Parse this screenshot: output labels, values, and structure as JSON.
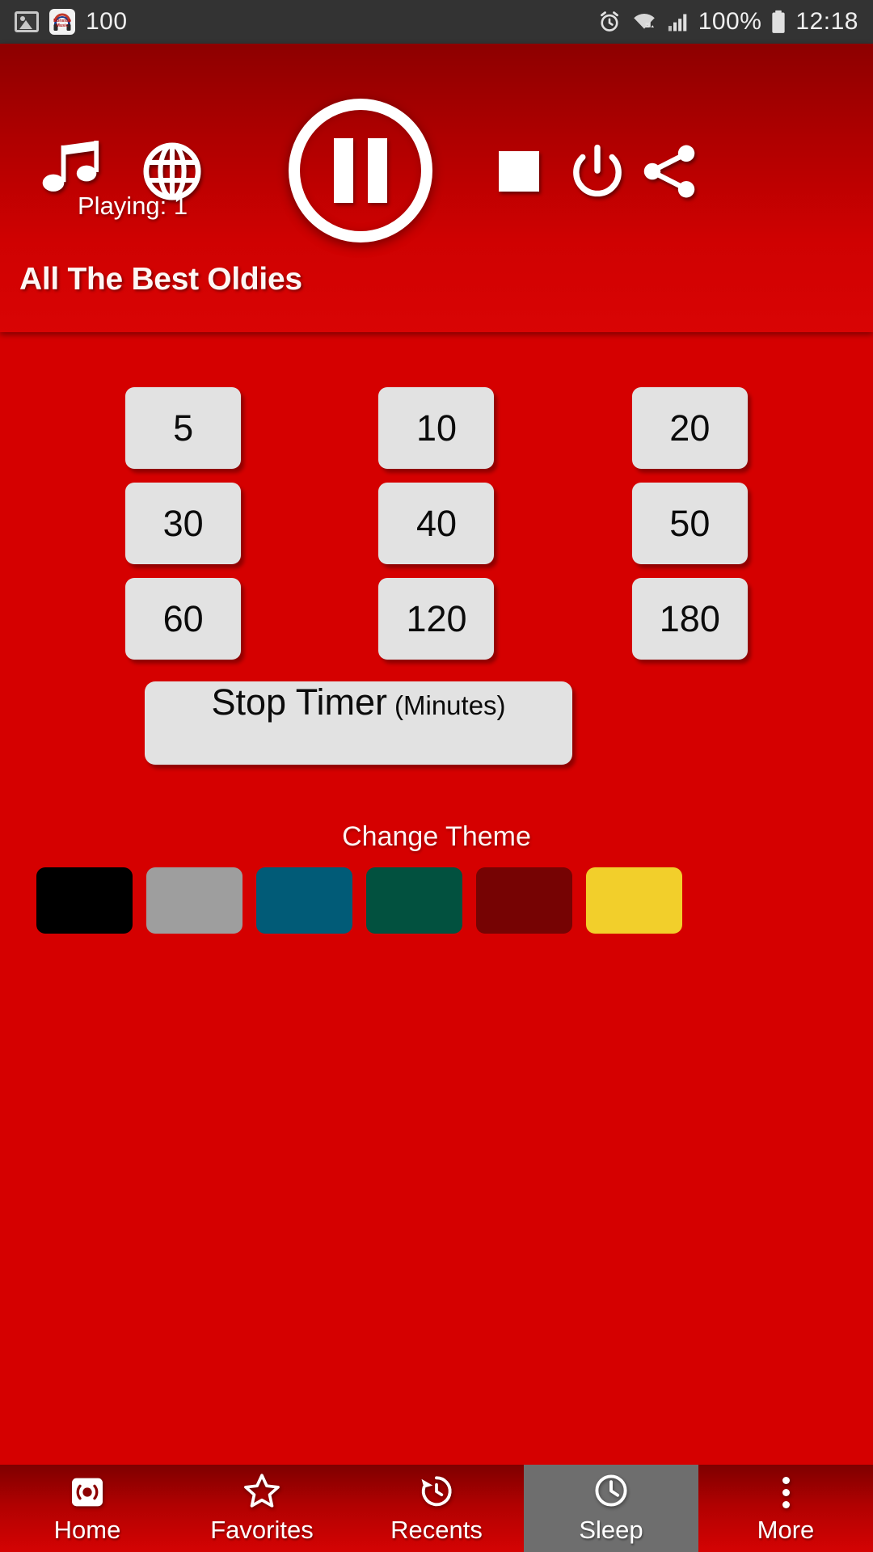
{
  "statusbar": {
    "left_icons": [
      "image-icon",
      "nonstop-music-app-icon"
    ],
    "notification_count": "100",
    "right_icons": [
      "alarm-icon",
      "wifi-icon",
      "signal-icon",
      "battery-icon"
    ],
    "battery_percent": "100%",
    "time": "12:18"
  },
  "player": {
    "music_icon": "music-note-icon",
    "globe_icon": "globe-icon",
    "playing_label": "Playing: 1",
    "play_pause_state": "pause-icon",
    "stop_icon": "stop-square-icon",
    "power_icon": "power-icon",
    "share_icon": "share-icon",
    "station_title": "All The Best Oldies"
  },
  "sleep": {
    "timer_options": [
      "5",
      "10",
      "20",
      "30",
      "40",
      "50",
      "60",
      "120",
      "180"
    ],
    "stop_timer_main": "Stop Timer",
    "stop_timer_sub": "(Minutes)",
    "theme_label": "Change Theme",
    "theme_colors": [
      "#000000",
      "#9e9e9e",
      "#015b77",
      "#02513f",
      "#760303",
      "#f2cf2b"
    ]
  },
  "nav": {
    "items": [
      {
        "label": "Home",
        "icon": "radio-icon",
        "active": false
      },
      {
        "label": "Favorites",
        "icon": "star-icon",
        "active": false
      },
      {
        "label": "Recents",
        "icon": "history-icon",
        "active": false
      },
      {
        "label": "Sleep",
        "icon": "clock-icon",
        "active": true
      },
      {
        "label": "More",
        "icon": "more-vert-icon",
        "active": false
      }
    ]
  },
  "colors": {
    "brand_red": "#d50000",
    "header_dark_red": "#8d0000",
    "statusbar": "#333333",
    "button_gray": "#e2e2e2",
    "active_nav": "#6e6e6e"
  }
}
